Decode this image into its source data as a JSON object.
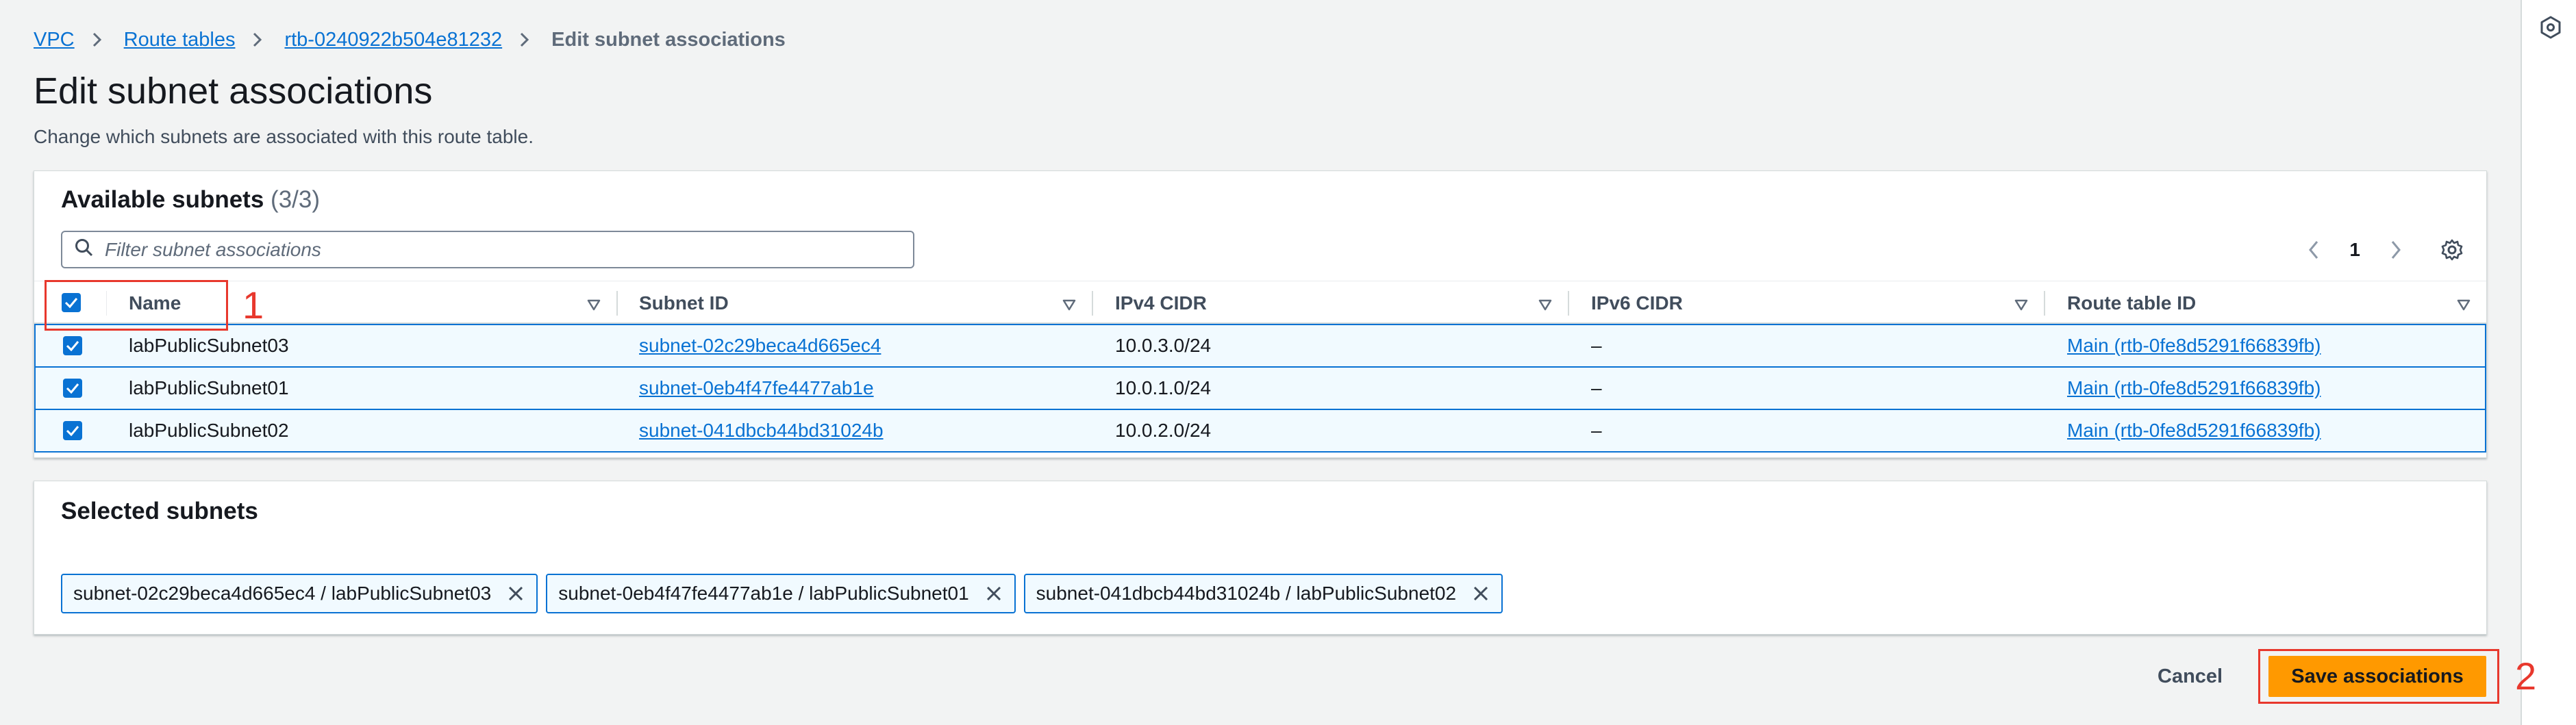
{
  "breadcrumb": {
    "items": [
      "VPC",
      "Route tables",
      "rtb-0240922b504e81232"
    ],
    "current": "Edit subnet associations"
  },
  "page": {
    "title": "Edit subnet associations",
    "description": "Change which subnets are associated with this route table."
  },
  "available": {
    "title": "Available subnets",
    "count": "(3/3)",
    "filter_placeholder": "Filter subnet associations",
    "page_number": "1",
    "columns": [
      "Name",
      "Subnet ID",
      "IPv4 CIDR",
      "IPv6 CIDR",
      "Route table ID"
    ],
    "rows": [
      {
        "name": "labPublicSubnet03",
        "subnet_id": "subnet-02c29beca4d665ec4",
        "ipv4": "10.0.3.0/24",
        "ipv6": "–",
        "route_table": "Main (rtb-0fe8d5291f66839fb)",
        "checked": true
      },
      {
        "name": "labPublicSubnet01",
        "subnet_id": "subnet-0eb4f47fe4477ab1e",
        "ipv4": "10.0.1.0/24",
        "ipv6": "–",
        "route_table": "Main (rtb-0fe8d5291f66839fb)",
        "checked": true
      },
      {
        "name": "labPublicSubnet02",
        "subnet_id": "subnet-041dbcb44bd31024b",
        "ipv4": "10.0.2.0/24",
        "ipv6": "–",
        "route_table": "Main (rtb-0fe8d5291f66839fb)",
        "checked": true
      }
    ]
  },
  "selected": {
    "title": "Selected subnets",
    "chips": [
      "subnet-02c29beca4d665ec4 / labPublicSubnet03",
      "subnet-0eb4f47fe4477ab1e / labPublicSubnet01",
      "subnet-041dbcb44bd31024b / labPublicSubnet02"
    ]
  },
  "actions": {
    "cancel_label": "Cancel",
    "save_label": "Save associations"
  },
  "annotations": [
    "1",
    "2"
  ],
  "colors": {
    "primary": "#0972d3",
    "save_button": "#ff9900",
    "annotation": "#e8382d"
  }
}
